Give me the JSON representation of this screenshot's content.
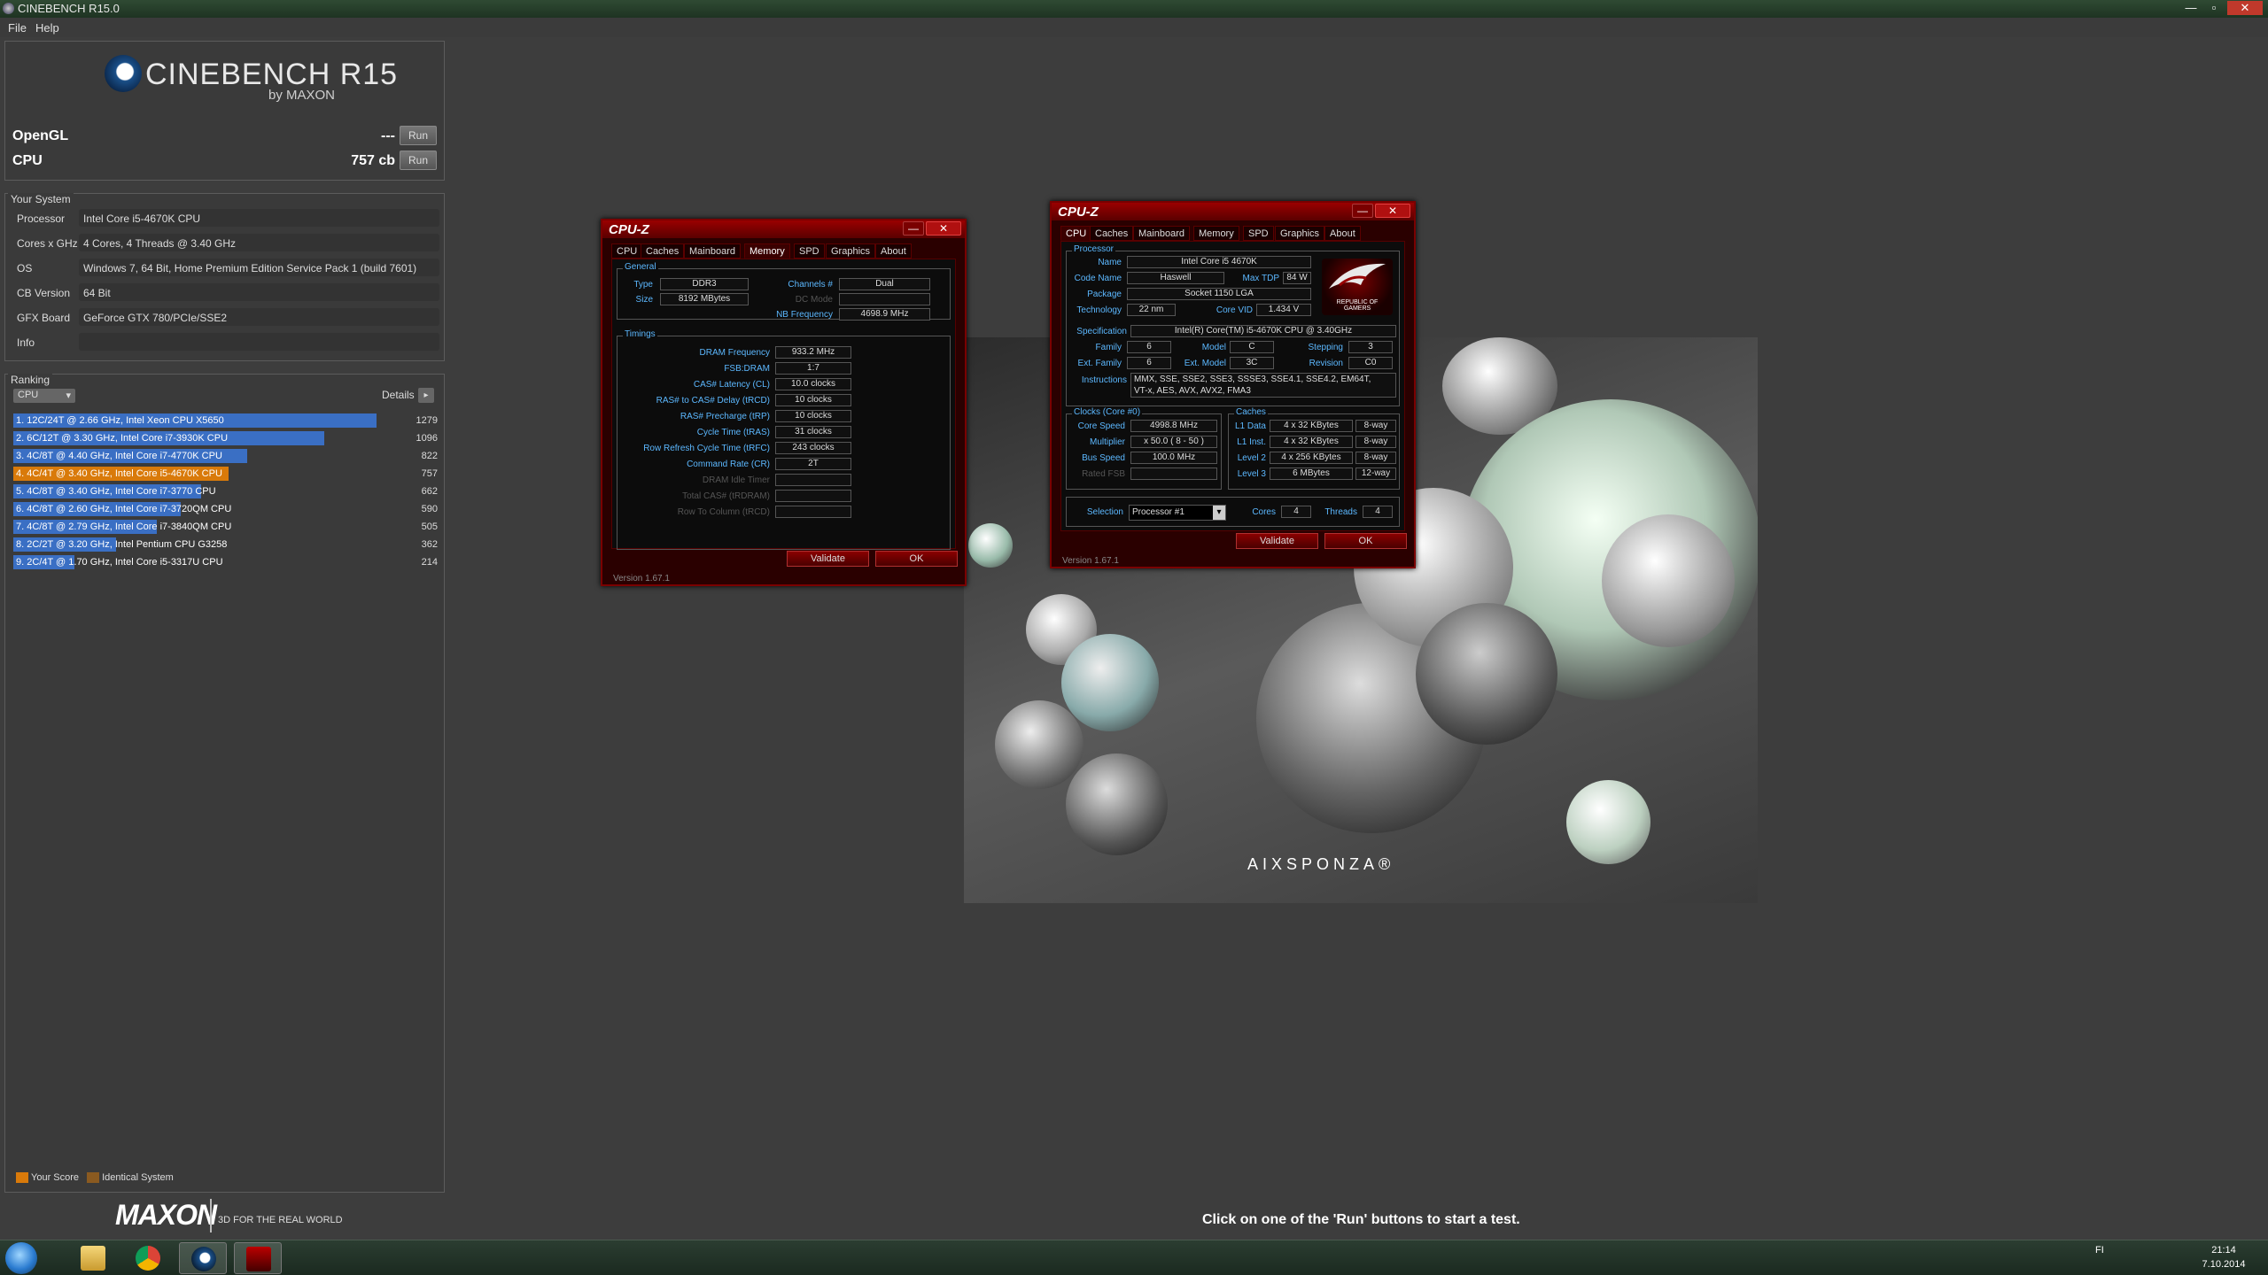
{
  "window": {
    "title": "CINEBENCH R15.0",
    "minimize": "—",
    "maximize": "▫",
    "close": "✕"
  },
  "menu": [
    "File",
    "Help"
  ],
  "logo": {
    "title": "CINEBENCH R15",
    "sub": "by MAXON"
  },
  "bench": [
    {
      "label": "OpenGL",
      "value": "---",
      "button": "Run"
    },
    {
      "label": "CPU",
      "value": "757 cb",
      "button": "Run"
    }
  ],
  "system": {
    "title": "Your System",
    "rows": [
      {
        "label": "Processor",
        "value": "Intel Core i5-4670K CPU"
      },
      {
        "label": "Cores x GHz",
        "value": "4 Cores, 4 Threads @ 3.40 GHz"
      },
      {
        "label": "OS",
        "value": "Windows 7, 64 Bit, Home Premium Edition Service Pack 1 (build 7601)"
      },
      {
        "label": "CB Version",
        "value": "64 Bit"
      },
      {
        "label": "GFX Board",
        "value": "GeForce GTX 780/PCIe/SSE2"
      },
      {
        "label": "Info",
        "value": ""
      }
    ]
  },
  "ranking": {
    "title": "Ranking",
    "select": "CPU",
    "details": "Details",
    "details_btn": "▸",
    "max_score": 1279,
    "rows": [
      {
        "text": "1. 12C/24T @ 2.66 GHz, Intel Xeon CPU X5650",
        "score": 1279,
        "color": "#3a6fc4"
      },
      {
        "text": "2. 6C/12T @ 3.30 GHz,  Intel Core i7-3930K CPU",
        "score": 1096,
        "color": "#3a6fc4"
      },
      {
        "text": "3. 4C/8T @ 4.40 GHz, Intel Core i7-4770K CPU",
        "score": 822,
        "color": "#3a6fc4"
      },
      {
        "text": "4. 4C/4T @ 3.40 GHz, Intel Core i5-4670K CPU",
        "score": 757,
        "color": "#d97a0a"
      },
      {
        "text": "5. 4C/8T @ 3.40 GHz,  Intel Core i7-3770 CPU",
        "score": 662,
        "color": "#3a6fc4"
      },
      {
        "text": "6. 4C/8T @ 2.60 GHz, Intel Core i7-3720QM CPU",
        "score": 590,
        "color": "#3a6fc4"
      },
      {
        "text": "7. 4C/8T @ 2.79 GHz,  Intel Core i7-3840QM CPU",
        "score": 505,
        "color": "#3a6fc4"
      },
      {
        "text": "8. 2C/2T @ 3.20 GHz, Intel Pentium CPU G3258",
        "score": 362,
        "color": "#3a6fc4"
      },
      {
        "text": "9. 2C/4T @ 1.70 GHz,  Intel Core i5-3317U CPU",
        "score": 214,
        "color": "#3a6fc4"
      }
    ],
    "legend": [
      {
        "label": "Your Score",
        "color": "#d97a0a"
      },
      {
        "label": "Identical System",
        "color": "#8a5a20"
      }
    ]
  },
  "footer": {
    "brand": "MAXON",
    "tagline": "3D FOR THE REAL WORLD",
    "status": "Click on one of the 'Run' buttons to start a test."
  },
  "render_watermark": "AIXSPONZA®",
  "cpuz_memory": {
    "title": "CPU-Z",
    "tabs": [
      "CPU",
      "Caches",
      "Mainboard",
      "Memory",
      "SPD",
      "Graphics",
      "About"
    ],
    "active_tab": "Memory",
    "general_title": "General",
    "type_label": "Type",
    "type": "DDR3",
    "size_label": "Size",
    "size": "8192 MBytes",
    "channels_label": "Channels #",
    "channels": "Dual",
    "dcmode_label": "DC Mode",
    "dcmode": "",
    "nbfreq_label": "NB Frequency",
    "nbfreq": "4698.9 MHz",
    "timings_title": "Timings",
    "timings": [
      {
        "label": "DRAM Frequency",
        "value": "933.2 MHz",
        "dim": false
      },
      {
        "label": "FSB:DRAM",
        "value": "1:7",
        "dim": false
      },
      {
        "label": "CAS# Latency (CL)",
        "value": "10.0 clocks",
        "dim": false
      },
      {
        "label": "RAS# to CAS# Delay (tRCD)",
        "value": "10 clocks",
        "dim": false
      },
      {
        "label": "RAS# Precharge (tRP)",
        "value": "10 clocks",
        "dim": false
      },
      {
        "label": "Cycle Time (tRAS)",
        "value": "31 clocks",
        "dim": false
      },
      {
        "label": "Row Refresh Cycle Time (tRFC)",
        "value": "243 clocks",
        "dim": false
      },
      {
        "label": "Command Rate (CR)",
        "value": "2T",
        "dim": false
      },
      {
        "label": "DRAM Idle Timer",
        "value": "",
        "dim": true
      },
      {
        "label": "Total CAS# (tRDRAM)",
        "value": "",
        "dim": true
      },
      {
        "label": "Row To Column (tRCD)",
        "value": "",
        "dim": true
      }
    ],
    "validate": "Validate",
    "ok": "OK",
    "version": "Version 1.67.1"
  },
  "cpuz_cpu": {
    "title": "CPU-Z",
    "tabs": [
      "CPU",
      "Caches",
      "Mainboard",
      "Memory",
      "SPD",
      "Graphics",
      "About"
    ],
    "active_tab": "CPU",
    "processor_title": "Processor",
    "name_label": "Name",
    "name": "Intel Core i5 4670K",
    "codename_label": "Code Name",
    "codename": "Haswell",
    "maxtdp_label": "Max TDP",
    "maxtdp": "84 W",
    "package_label": "Package",
    "package": "Socket 1150 LGA",
    "tech_label": "Technology",
    "tech": "22 nm",
    "corevid_label": "Core VID",
    "corevid": "1.434 V",
    "spec_label": "Specification",
    "spec": "Intel(R) Core(TM) i5-4670K CPU @ 3.40GHz",
    "family_label": "Family",
    "family": "6",
    "model_label": "Model",
    "model": "C",
    "stepping_label": "Stepping",
    "stepping": "3",
    "extfamily_label": "Ext. Family",
    "extfamily": "6",
    "extmodel_label": "Ext. Model",
    "extmodel": "3C",
    "revision_label": "Revision",
    "revision": "C0",
    "instr_label": "Instructions",
    "instr1": "MMX, SSE, SSE2, SSE3, SSSE3, SSE4.1, SSE4.2, EM64T,",
    "instr2": "VT-x, AES, AVX, AVX2, FMA3",
    "rog_text": "REPUBLIC OF GAMERS",
    "clocks_title": "Clocks (Core #0)",
    "corespeed_label": "Core Speed",
    "corespeed": "4998.8 MHz",
    "multiplier_label": "Multiplier",
    "multiplier": "x 50.0 ( 8 - 50 )",
    "busspeed_label": "Bus Speed",
    "busspeed": "100.0 MHz",
    "ratedfsb_label": "Rated FSB",
    "ratedfsb": "",
    "caches_title": "Caches",
    "l1d_label": "L1 Data",
    "l1d": "4 x 32 KBytes",
    "l1d_way": "8-way",
    "l1i_label": "L1 Inst.",
    "l1i": "4 x 32 KBytes",
    "l1i_way": "8-way",
    "l2_label": "Level 2",
    "l2": "4 x 256 KBytes",
    "l2_way": "8-way",
    "l3_label": "Level 3",
    "l3": "6 MBytes",
    "l3_way": "12-way",
    "selection_label": "Selection",
    "selection": "Processor #1",
    "cores_label": "Cores",
    "cores": "4",
    "threads_label": "Threads",
    "threads": "4",
    "validate": "Validate",
    "ok": "OK",
    "version": "Version 1.67.1"
  },
  "taskbar": {
    "lang": "FI",
    "time": "21:14",
    "date": "7.10.2014"
  }
}
